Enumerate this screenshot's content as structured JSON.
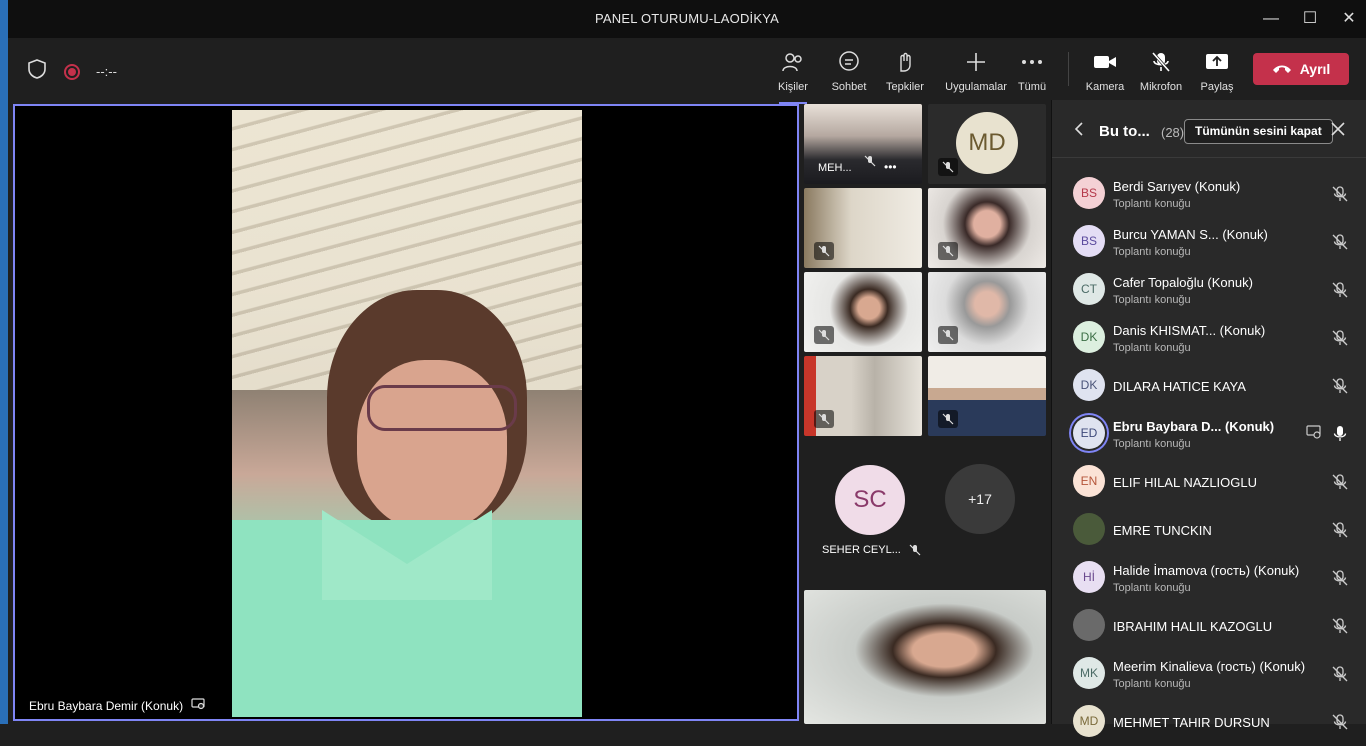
{
  "window": {
    "title": "PANEL OTURUMU-LAODİKYA"
  },
  "toolbar": {
    "timer": "--:--",
    "people": "Kişiler",
    "chat": "Sohbet",
    "reactions": "Tepkiler",
    "apps": "Uygulamalar",
    "more": "Tümü",
    "camera": "Kamera",
    "mic": "Mikrofon",
    "share": "Paylaş",
    "leave": "Ayrıl"
  },
  "main_video": {
    "name": "Ebru Baybara Demir (Konuk)"
  },
  "grid": {
    "tile1_name": "MEH...",
    "md_initials": "MD",
    "sc_initials": "SC",
    "sc_name": "SEHER CEYL...",
    "overflow": "+17"
  },
  "panel": {
    "title": "Bu to...",
    "count": "(28)",
    "mute_all": "Tümünün sesini kapat",
    "participants": [
      {
        "initials": "BS",
        "name": "Berdi Sarıyev (Konuk)",
        "role": "Toplantı konuğu",
        "color": "#f4d1d5",
        "text": "#b5394a"
      },
      {
        "initials": "BS",
        "name": "Burcu YAMAN S...  (Konuk)",
        "role": "Toplantı konuğu",
        "color": "#e4ddf5",
        "text": "#5b4a9e"
      },
      {
        "initials": "CT",
        "name": "Cafer Topaloğlu (Konuk)",
        "role": "Toplantı konuğu",
        "color": "#dfe8e6",
        "text": "#4b6b66"
      },
      {
        "initials": "DK",
        "name": "Danis KHISMAT...  (Konuk)",
        "role": "Toplantı konuğu",
        "color": "#dcefdf",
        "text": "#3b6e45"
      },
      {
        "initials": "DK",
        "name": "DILARA HATICE KAYA",
        "role": "",
        "color": "#dfe3f0",
        "text": "#4a5479"
      },
      {
        "initials": "ED",
        "name": "Ebru Baybara D...  (Konuk)",
        "role": "Toplantı konuğu",
        "color": "#dfe3f0",
        "text": "#3e4a7a"
      },
      {
        "initials": "EN",
        "name": "ELIF HILAL NAZLIOGLU",
        "role": "",
        "color": "#fbe3d6",
        "text": "#b5563a"
      },
      {
        "initials": "",
        "name": "EMRE TUNCKIN",
        "role": "",
        "color": "#4a5a3a",
        "text": "#fff"
      },
      {
        "initials": "Hİ",
        "name": "Halide İmamova (гость) (Konuk)",
        "role": "Toplantı konuğu",
        "color": "#e8dff2",
        "text": "#6a4a8e"
      },
      {
        "initials": "",
        "name": "IBRAHIM HALIL KAZOGLU",
        "role": "",
        "color": "#6a6a6a",
        "text": "#fff"
      },
      {
        "initials": "MK",
        "name": "Meerim Kinalieva (гость) (Konuk)",
        "role": "Toplantı konuğu",
        "color": "#dfe8e6",
        "text": "#4b6b66"
      },
      {
        "initials": "MD",
        "name": "MEHMET TAHIR DURSUN",
        "role": "",
        "color": "#e8e2cf",
        "text": "#7a6a3a"
      }
    ]
  }
}
